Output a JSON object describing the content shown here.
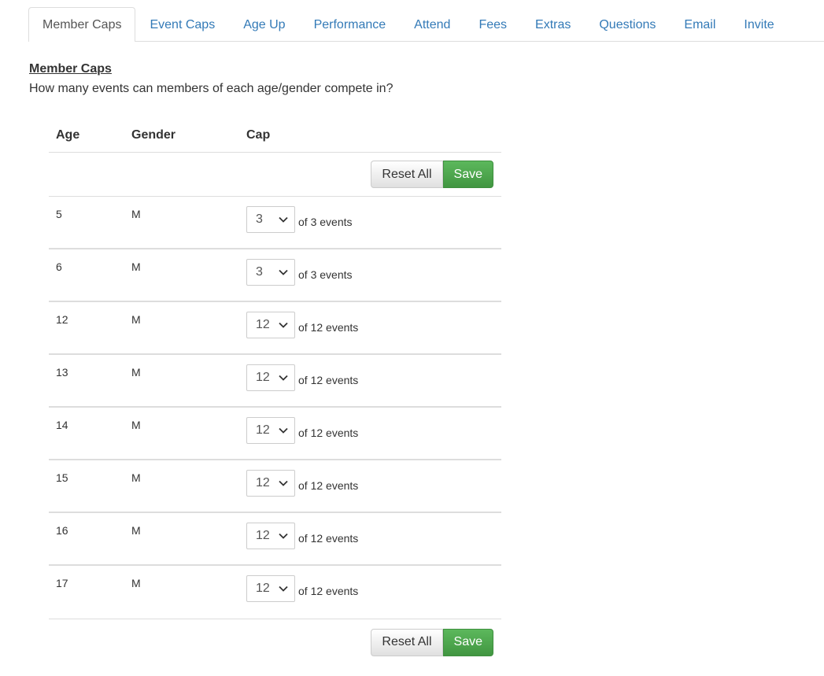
{
  "tabs": [
    {
      "label": "Member Caps",
      "active": true
    },
    {
      "label": "Event Caps"
    },
    {
      "label": "Age Up"
    },
    {
      "label": "Performance"
    },
    {
      "label": "Attend"
    },
    {
      "label": "Fees"
    },
    {
      "label": "Extras"
    },
    {
      "label": "Questions"
    },
    {
      "label": "Email"
    },
    {
      "label": "Invite"
    }
  ],
  "section": {
    "title": "Member Caps",
    "description": "How many events can members of each age/gender compete in?"
  },
  "table": {
    "headers": {
      "age": "Age",
      "gender": "Gender",
      "cap": "Cap"
    },
    "rows": [
      {
        "age": "5",
        "gender": "M",
        "cap": "3",
        "of_text": "of 3 events"
      },
      {
        "age": "6",
        "gender": "M",
        "cap": "3",
        "of_text": "of 3 events"
      },
      {
        "age": "12",
        "gender": "M",
        "cap": "12",
        "of_text": "of 12 events"
      },
      {
        "age": "13",
        "gender": "M",
        "cap": "12",
        "of_text": "of 12 events"
      },
      {
        "age": "14",
        "gender": "M",
        "cap": "12",
        "of_text": "of 12 events"
      },
      {
        "age": "15",
        "gender": "M",
        "cap": "12",
        "of_text": "of 12 events"
      },
      {
        "age": "16",
        "gender": "M",
        "cap": "12",
        "of_text": "of 12 events"
      },
      {
        "age": "17",
        "gender": "M",
        "cap": "12",
        "of_text": "of 12 events"
      }
    ]
  },
  "buttons": {
    "reset_label": "Reset All",
    "save_label": "Save"
  },
  "colors": {
    "link": "#337ab7",
    "save": "#5cb85c",
    "border": "#dddddd"
  }
}
